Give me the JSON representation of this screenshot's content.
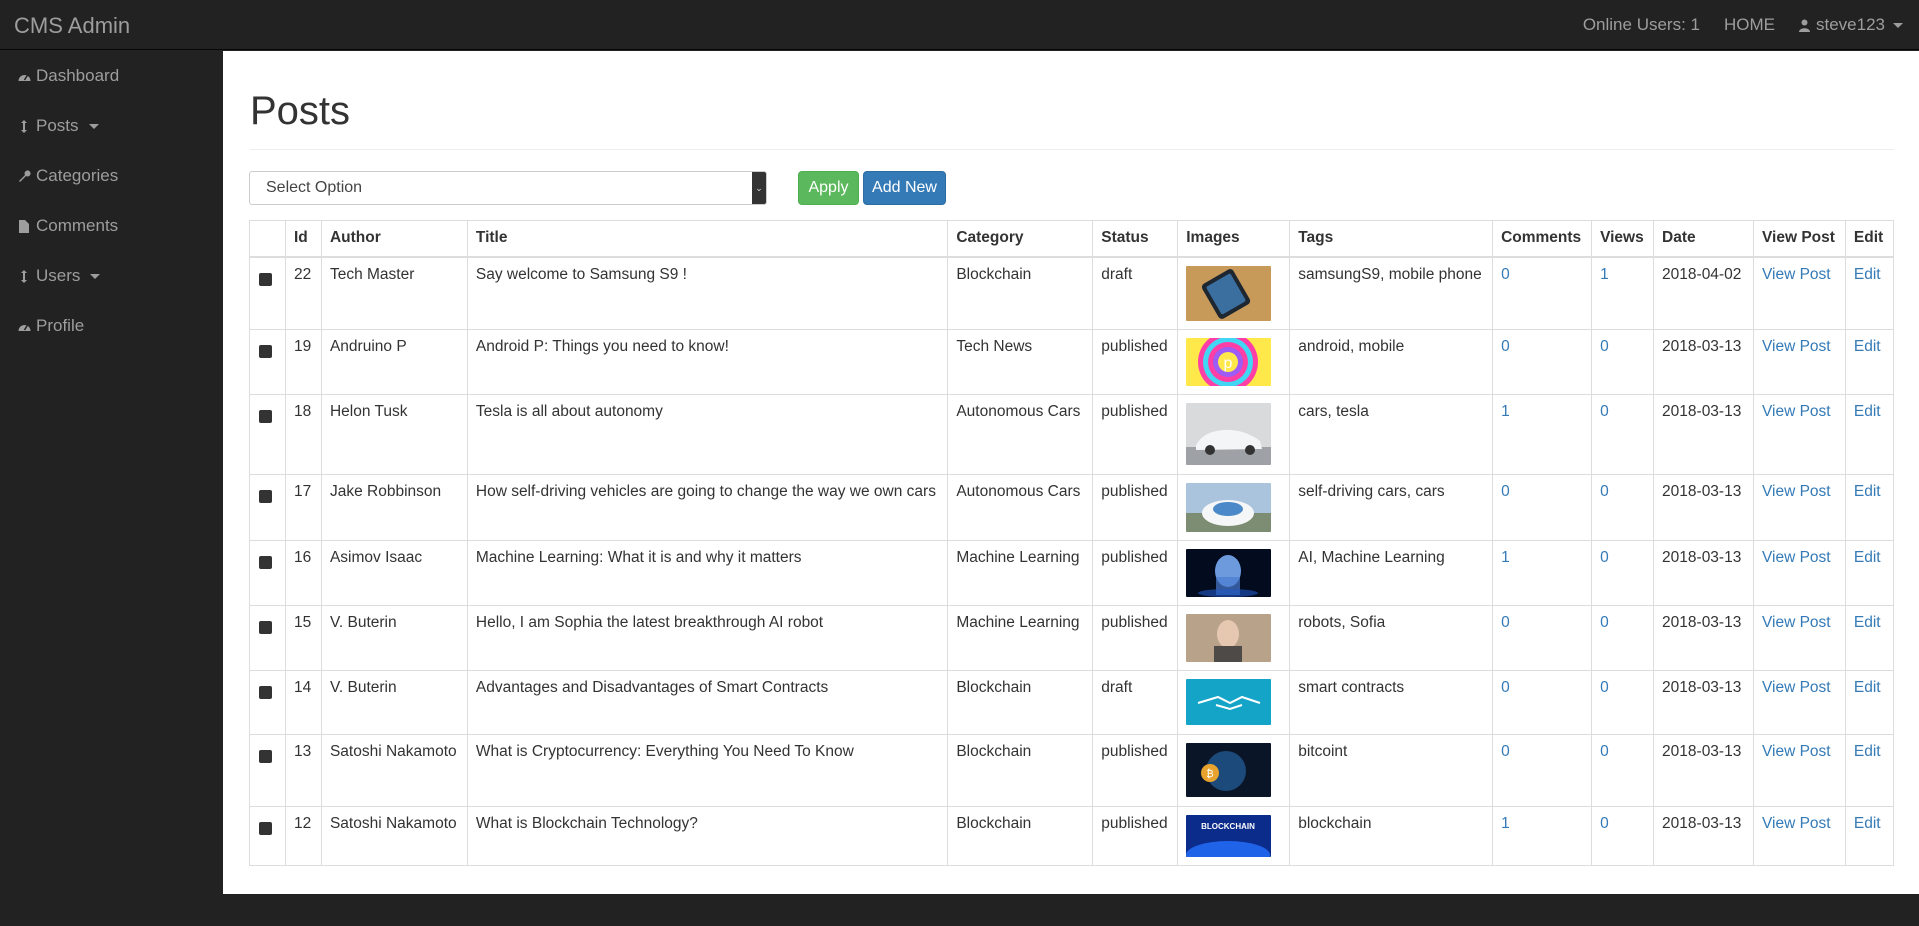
{
  "app": {
    "title": "CMS Admin"
  },
  "topnav": {
    "online_users": "Online Users: 1",
    "home": "HOME",
    "user": "steve123"
  },
  "sidebar": {
    "items": [
      {
        "label": "Dashboard",
        "icon": "dashboard-icon",
        "dropdown": false
      },
      {
        "label": "Posts",
        "icon": "arrows-v-icon",
        "dropdown": true
      },
      {
        "label": "Categories",
        "icon": "wrench-icon",
        "dropdown": false
      },
      {
        "label": "Comments",
        "icon": "file-icon",
        "dropdown": false
      },
      {
        "label": "Users",
        "icon": "arrows-v-icon",
        "dropdown": true
      },
      {
        "label": "Profile",
        "icon": "dashboard-icon",
        "dropdown": false
      }
    ]
  },
  "page": {
    "title": "Posts"
  },
  "controls": {
    "select_value": "Select Option",
    "apply_label": "Apply",
    "add_new_label": "Add New"
  },
  "colors": {
    "success": "#5cb85c",
    "primary": "#337ab7",
    "link": "#337ab7",
    "navbar": "#222222"
  },
  "table": {
    "headers": [
      "",
      "Id",
      "Author",
      "Title",
      "Category",
      "Status",
      "Images",
      "Tags",
      "Comments",
      "Views",
      "Date",
      "View Post",
      "Edit"
    ],
    "rows": [
      {
        "id": "22",
        "author": "Tech Master",
        "title": "Say welcome to Samsung S9 !",
        "category": "Blockchain",
        "status": "draft",
        "image": "phone-on-table",
        "tags": "samsungS9, mobile phone",
        "comments": "0",
        "views": "1",
        "date": "2018-04-02",
        "view": "View Post",
        "edit": "Edit"
      },
      {
        "id": "19",
        "author": "Andruino P",
        "title": "Android P: Things you need to know!",
        "category": "Tech News",
        "status": "published",
        "image": "android-p-logo",
        "tags": "android, mobile",
        "comments": "0",
        "views": "0",
        "date": "2018-03-13",
        "view": "View Post",
        "edit": "Edit"
      },
      {
        "id": "18",
        "author": "Helon Tusk",
        "title": "Tesla is all about autonomy",
        "category": "Autonomous Cars",
        "status": "published",
        "image": "white-tesla",
        "tags": "cars, tesla",
        "comments": "1",
        "views": "0",
        "date": "2018-03-13",
        "view": "View Post",
        "edit": "Edit"
      },
      {
        "id": "17",
        "author": "Jake Robbinson",
        "title": "How self-driving vehicles are going to change the way we own cars",
        "category": "Autonomous Cars",
        "status": "published",
        "image": "self-driving-car",
        "tags": "self-driving cars, cars",
        "comments": "0",
        "views": "0",
        "date": "2018-03-13",
        "view": "View Post",
        "edit": "Edit"
      },
      {
        "id": "16",
        "author": "Asimov Isaac",
        "title": "Machine Learning: What it is and why it matters",
        "category": "Machine Learning",
        "status": "published",
        "image": "ai-robot-blue",
        "tags": "AI, Machine Learning",
        "comments": "1",
        "views": "0",
        "date": "2018-03-13",
        "view": "View Post",
        "edit": "Edit"
      },
      {
        "id": "15",
        "author": "V. Buterin",
        "title": "Hello, I am Sophia the latest breakthrough AI robot",
        "category": "Machine Learning",
        "status": "published",
        "image": "sophia-robot",
        "tags": "robots, Sofia",
        "comments": "0",
        "views": "0",
        "date": "2018-03-13",
        "view": "View Post",
        "edit": "Edit"
      },
      {
        "id": "14",
        "author": "V. Buterin",
        "title": "Advantages and Disadvantages of Smart Contracts",
        "category": "Blockchain",
        "status": "draft",
        "image": "handshake-cyan",
        "tags": "smart contracts",
        "comments": "0",
        "views": "0",
        "date": "2018-03-13",
        "view": "View Post",
        "edit": "Edit"
      },
      {
        "id": "13",
        "author": "Satoshi Nakamoto",
        "title": "What is Cryptocurrency: Everything You Need To Know",
        "category": "Blockchain",
        "status": "published",
        "image": "bitcoin-globe",
        "tags": "bitcoint",
        "comments": "0",
        "views": "0",
        "date": "2018-03-13",
        "view": "View Post",
        "edit": "Edit"
      },
      {
        "id": "12",
        "author": "Satoshi Nakamoto",
        "title": "What is Blockchain Technology?",
        "category": "Blockchain",
        "status": "published",
        "image": "blockchain-banner",
        "tags": "blockchain",
        "comments": "1",
        "views": "0",
        "date": "2018-03-13",
        "view": "View Post",
        "edit": "Edit"
      }
    ],
    "thumb_labels": {
      "blockchain-banner": "BLOCKCHAIN"
    }
  }
}
